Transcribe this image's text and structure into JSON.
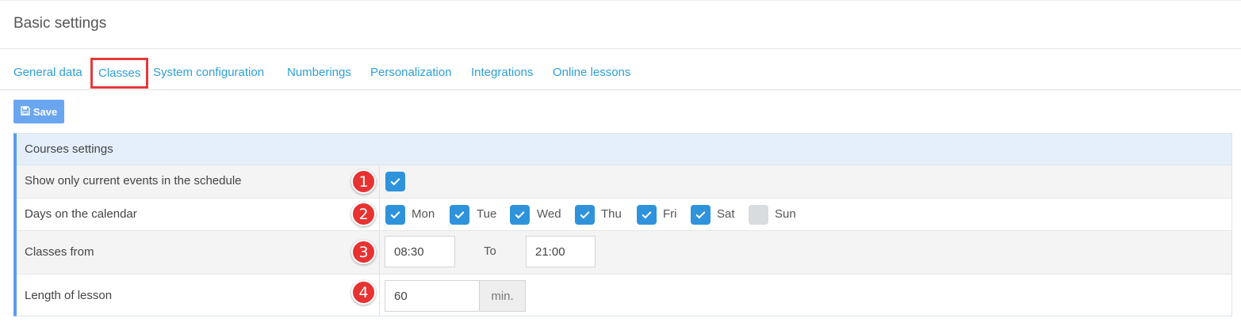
{
  "page": {
    "title": "Basic settings"
  },
  "tabs": [
    {
      "label": "General data"
    },
    {
      "label": "Classes"
    },
    {
      "label": "System configuration"
    },
    {
      "label": "Numberings"
    },
    {
      "label": "Personalization"
    },
    {
      "label": "Integrations"
    },
    {
      "label": "Online lessons"
    }
  ],
  "active_tab": "Classes",
  "toolbar": {
    "save_label": "Save",
    "save_icon": "floppy-disk-icon"
  },
  "panel": {
    "title": "Courses settings",
    "rows": [
      {
        "badge": "1",
        "label": "Show only current events in the schedule",
        "checked": true
      },
      {
        "badge": "2",
        "label": "Days on the calendar"
      },
      {
        "badge": "3",
        "label": "Classes from",
        "from_value": "08:30",
        "to_label": "To",
        "to_value": "21:00"
      },
      {
        "badge": "4",
        "label": "Length of lesson",
        "value": "60",
        "unit": "min."
      }
    ],
    "days": [
      {
        "label": "Mon",
        "checked": true
      },
      {
        "label": "Tue",
        "checked": true
      },
      {
        "label": "Wed",
        "checked": true
      },
      {
        "label": "Thu",
        "checked": true
      },
      {
        "label": "Fri",
        "checked": true
      },
      {
        "label": "Sat",
        "checked": true
      },
      {
        "label": "Sun",
        "checked": false
      }
    ]
  },
  "colors": {
    "accent": "#2f93dc",
    "link": "#2d9fd8",
    "badge": "#e83232",
    "highlight_border": "#e5393b",
    "save_button": "#6aa6f0"
  }
}
